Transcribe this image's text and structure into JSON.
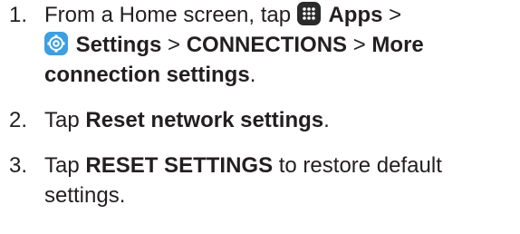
{
  "steps": [
    {
      "number": "1.",
      "text_1": "From a Home screen, tap",
      "icon_1": "apps-grid-icon",
      "bold_1": "Apps",
      "sep_1": ">",
      "icon_2": "settings-gear-icon",
      "bold_2": "Settings",
      "sep_2": ">",
      "bold_3": "CONNECTIONS",
      "sep_3": ">",
      "bold_4": "More connection settings",
      "end": "."
    },
    {
      "number": "2.",
      "text_1": "Tap",
      "bold_1": "Reset network settings",
      "end": "."
    },
    {
      "number": "3.",
      "text_1": "Tap",
      "bold_1": "RESET SETTINGS",
      "text_2": "to restore default settings."
    }
  ],
  "colors": {
    "text": "#231f20",
    "apps_icon_bg": "#2b2b2b",
    "settings_icon_bg": "#3d9fe0"
  }
}
